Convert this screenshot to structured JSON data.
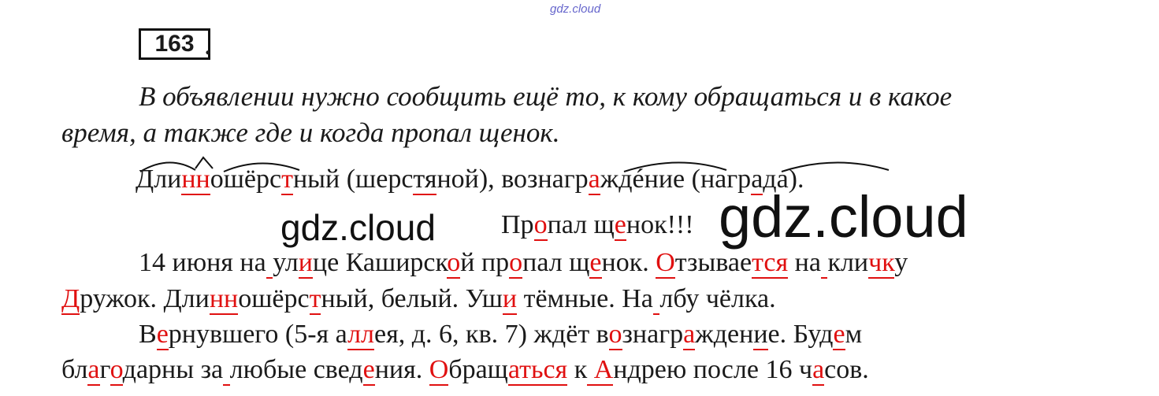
{
  "watermark_top": "gdz.cloud",
  "task_number": "163",
  "task_dot": ".",
  "answer": {
    "line1": "В объявлении нужно сообщить ещё то, к кому обращаться и в какое",
    "line2": "время, а также где и когда пропал щенок."
  },
  "word_analysis": {
    "w1_a": "Дли",
    "w1_b": "нн",
    "w1_c": "ошёрс",
    "w1_d": "т",
    "w1_e": "ный",
    "w1_check": " (шерс",
    "w1_check_b": "тя",
    "w1_check_c": "ной), ",
    "w2_a": "вознагр",
    "w2_b": "а",
    "w2_c": "ждéние (нагр",
    "w2_d": "а",
    "w2_e": "да)."
  },
  "heading": {
    "a": "Пр",
    "b": "о",
    "c": "пал щ",
    "d": "е",
    "e": "нок!!!"
  },
  "watermark_small": "gdz.cloud",
  "watermark_large": "gdz.cloud",
  "ad": {
    "l1": [
      "14 июня на",
      " ",
      "ул",
      "и",
      "це Кашир",
      "с",
      "к",
      "о",
      "й пр",
      "о",
      "пал щ",
      "е",
      "нок. ",
      "О",
      "тзывае",
      "т",
      "ся",
      " на",
      " ",
      "кли",
      "ч",
      "к",
      "у"
    ],
    "l2": [
      "Д",
      "ружок. Дли",
      "нн",
      "ошёрс",
      "т",
      "ный, белый. Уш",
      "и",
      " тёмные. На",
      " ",
      "лбу чёлка."
    ],
    "l3": [
      "В",
      "е",
      "рнувшего (5-я а",
      "лл",
      "ея, д. 6, кв. 7) ждёт в",
      "о",
      "знагр",
      "а",
      "жден",
      "и",
      "е. Буд",
      "е",
      "м"
    ],
    "l4": [
      "бл",
      "а",
      "г",
      "о",
      "дарны за",
      " ",
      "любые свед",
      "е",
      "ния. ",
      "О",
      "бращ",
      "аться",
      " к",
      " ",
      "А",
      "ндрею после 16 ч",
      "а",
      "сов."
    ]
  }
}
